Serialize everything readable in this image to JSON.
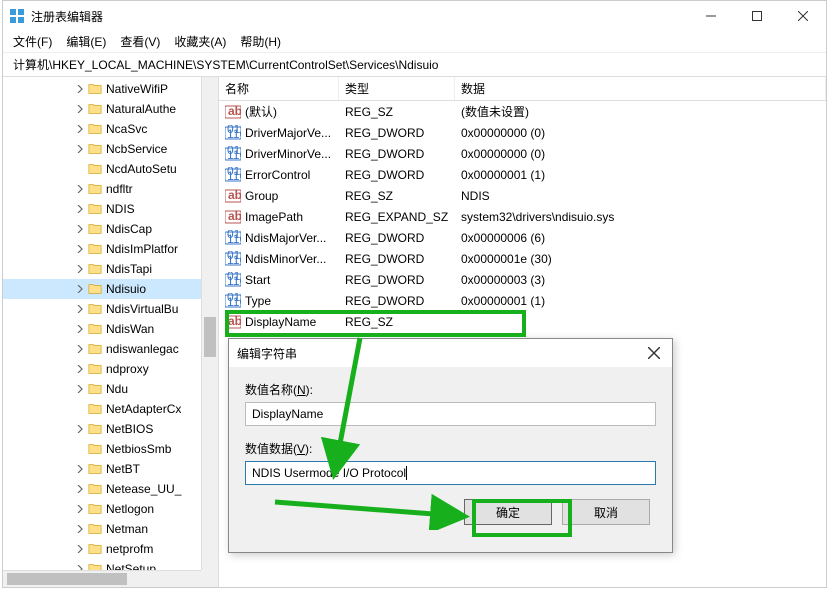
{
  "window": {
    "title": "注册表编辑器"
  },
  "menu": {
    "file": "文件(F)",
    "edit": "编辑(E)",
    "view": "查看(V)",
    "favorites": "收藏夹(A)",
    "help": "帮助(H)"
  },
  "address": "计算机\\HKEY_LOCAL_MACHINE\\SYSTEM\\CurrentControlSet\\Services\\Ndisuio",
  "tree": [
    {
      "label": "NativeWifiP",
      "expandable": true
    },
    {
      "label": "NaturalAuthe",
      "expandable": true
    },
    {
      "label": "NcaSvc",
      "expandable": true
    },
    {
      "label": "NcbService",
      "expandable": true
    },
    {
      "label": "NcdAutoSetu",
      "expandable": false
    },
    {
      "label": "ndfltr",
      "expandable": true
    },
    {
      "label": "NDIS",
      "expandable": true
    },
    {
      "label": "NdisCap",
      "expandable": true
    },
    {
      "label": "NdisImPlatfor",
      "expandable": true
    },
    {
      "label": "NdisTapi",
      "expandable": true
    },
    {
      "label": "Ndisuio",
      "expandable": true,
      "selected": true
    },
    {
      "label": "NdisVirtualBu",
      "expandable": true
    },
    {
      "label": "NdisWan",
      "expandable": true
    },
    {
      "label": "ndiswanlegac",
      "expandable": true
    },
    {
      "label": "ndproxy",
      "expandable": true
    },
    {
      "label": "Ndu",
      "expandable": true
    },
    {
      "label": "NetAdapterCx",
      "expandable": false
    },
    {
      "label": "NetBIOS",
      "expandable": true
    },
    {
      "label": "NetbiosSmb",
      "expandable": false
    },
    {
      "label": "NetBT",
      "expandable": true
    },
    {
      "label": "Netease_UU_",
      "expandable": true
    },
    {
      "label": "Netlogon",
      "expandable": true
    },
    {
      "label": "Netman",
      "expandable": true
    },
    {
      "label": "netprofm",
      "expandable": true
    },
    {
      "label": "NetSetup",
      "expandable": true
    }
  ],
  "columns": {
    "name": "名称",
    "type": "类型",
    "data": "数据"
  },
  "rows": [
    {
      "icon": "str",
      "name": "(默认)",
      "type": "REG_SZ",
      "data": "(数值未设置)"
    },
    {
      "icon": "bin",
      "name": "DriverMajorVe...",
      "type": "REG_DWORD",
      "data": "0x00000000 (0)"
    },
    {
      "icon": "bin",
      "name": "DriverMinorVe...",
      "type": "REG_DWORD",
      "data": "0x00000000 (0)"
    },
    {
      "icon": "bin",
      "name": "ErrorControl",
      "type": "REG_DWORD",
      "data": "0x00000001 (1)"
    },
    {
      "icon": "str",
      "name": "Group",
      "type": "REG_SZ",
      "data": "NDIS"
    },
    {
      "icon": "str",
      "name": "ImagePath",
      "type": "REG_EXPAND_SZ",
      "data": "system32\\drivers\\ndisuio.sys"
    },
    {
      "icon": "bin",
      "name": "NdisMajorVer...",
      "type": "REG_DWORD",
      "data": "0x00000006 (6)"
    },
    {
      "icon": "bin",
      "name": "NdisMinorVer...",
      "type": "REG_DWORD",
      "data": "0x0000001e (30)"
    },
    {
      "icon": "bin",
      "name": "Start",
      "type": "REG_DWORD",
      "data": "0x00000003 (3)"
    },
    {
      "icon": "bin",
      "name": "Type",
      "type": "REG_DWORD",
      "data": "0x00000001 (1)"
    },
    {
      "icon": "str",
      "name": "DisplayName",
      "type": "REG_SZ",
      "data": ""
    }
  ],
  "dialog": {
    "title": "编辑字符串",
    "name_label_pre": "数值名称(",
    "name_label_key": "N",
    "name_label_post": "):",
    "name_value": "DisplayName",
    "data_label_pre": "数值数据(",
    "data_label_key": "V",
    "data_label_post": "):",
    "data_value": "NDIS Usermode I/O Protocol",
    "ok": "确定",
    "cancel": "取消"
  }
}
